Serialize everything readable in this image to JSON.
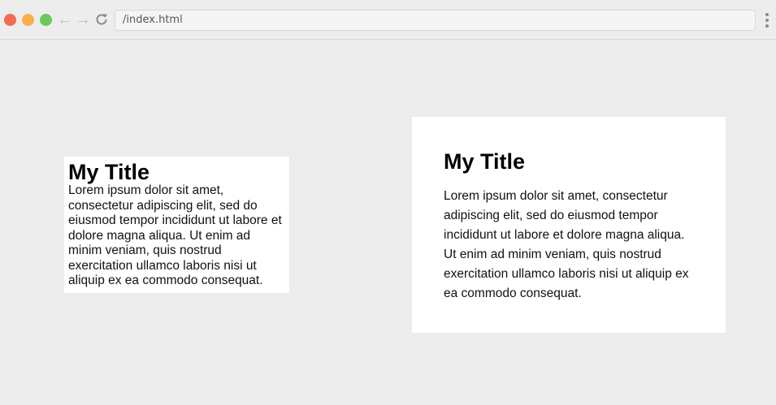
{
  "browser": {
    "url": "/index.html",
    "icons": {
      "back": "arrow-left-icon",
      "forward": "arrow-right-icon",
      "reload": "reload-icon",
      "menu": "kebab-menu-icon"
    },
    "traffic_lights": [
      "#f26d50",
      "#f9b04b",
      "#6cc95c"
    ]
  },
  "cards": {
    "compact": {
      "title": "My Title",
      "body": "Lorem ipsum dolor sit amet, consectetur adipiscing elit, sed do eiusmod tempor incididunt ut labore et dolore magna aliqua. Ut enim ad minim veniam, quis nostrud exercitation ullamco laboris nisi ut aliquip ex ea commodo consequat."
    },
    "spacious": {
      "title": "My Title",
      "body": "Lorem ipsum dolor sit amet, consectetur adipiscing elit, sed do eiusmod tempor incididunt ut labore et dolore magna aliqua. Ut enim ad minim veniam, quis nostrud exercitation ullamco laboris nisi ut aliquip ex ea commodo consequat."
    }
  },
  "colors": {
    "page_background": "#ececec",
    "card_background": "#ffffff"
  }
}
